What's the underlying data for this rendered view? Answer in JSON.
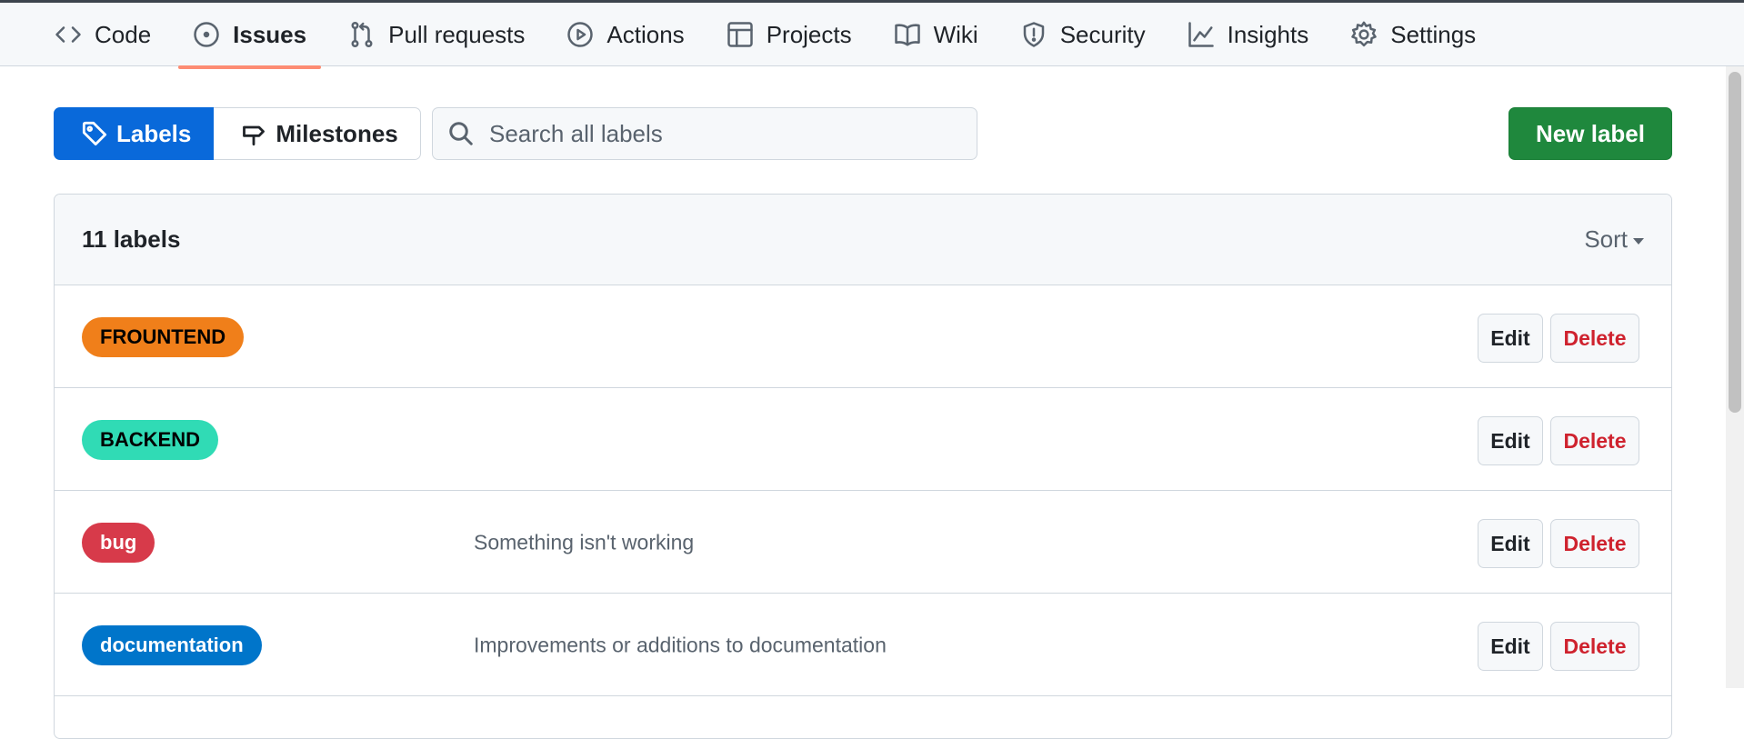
{
  "repo_nav": {
    "items": [
      {
        "label": "Code",
        "icon": "code-icon",
        "active": false
      },
      {
        "label": "Issues",
        "icon": "issue-opened-icon",
        "active": true
      },
      {
        "label": "Pull requests",
        "icon": "git-pull-request-icon",
        "active": false
      },
      {
        "label": "Actions",
        "icon": "play-icon",
        "active": false
      },
      {
        "label": "Projects",
        "icon": "table-icon",
        "active": false
      },
      {
        "label": "Wiki",
        "icon": "book-icon",
        "active": false
      },
      {
        "label": "Security",
        "icon": "shield-icon",
        "active": false
      },
      {
        "label": "Insights",
        "icon": "graph-icon",
        "active": false
      },
      {
        "label": "Settings",
        "icon": "gear-icon",
        "active": false
      }
    ]
  },
  "subnav": {
    "labels": "Labels",
    "milestones": "Milestones"
  },
  "search": {
    "placeholder": "Search all labels",
    "value": ""
  },
  "new_label_button": "New label",
  "labels_box": {
    "count_text": "11 labels",
    "sort_label": "Sort",
    "rows": [
      {
        "name": "FROUNTEND",
        "description": "",
        "color": "#f07f1a",
        "text_color": "#000000"
      },
      {
        "name": "BACKEND",
        "description": "",
        "color": "#30dbb5",
        "text_color": "#000000"
      },
      {
        "name": "bug",
        "description": "Something isn't working",
        "color": "#d73a4a",
        "text_color": "#ffffff"
      },
      {
        "name": "documentation",
        "description": "Improvements or additions to documentation",
        "color": "#0075ca",
        "text_color": "#ffffff"
      }
    ],
    "edit_label": "Edit",
    "delete_label": "Delete"
  },
  "colors": {
    "accent": "#0969da",
    "primary_button": "#1f883d",
    "active_tab_underline": "#fd8c73",
    "danger": "#cf222e"
  }
}
